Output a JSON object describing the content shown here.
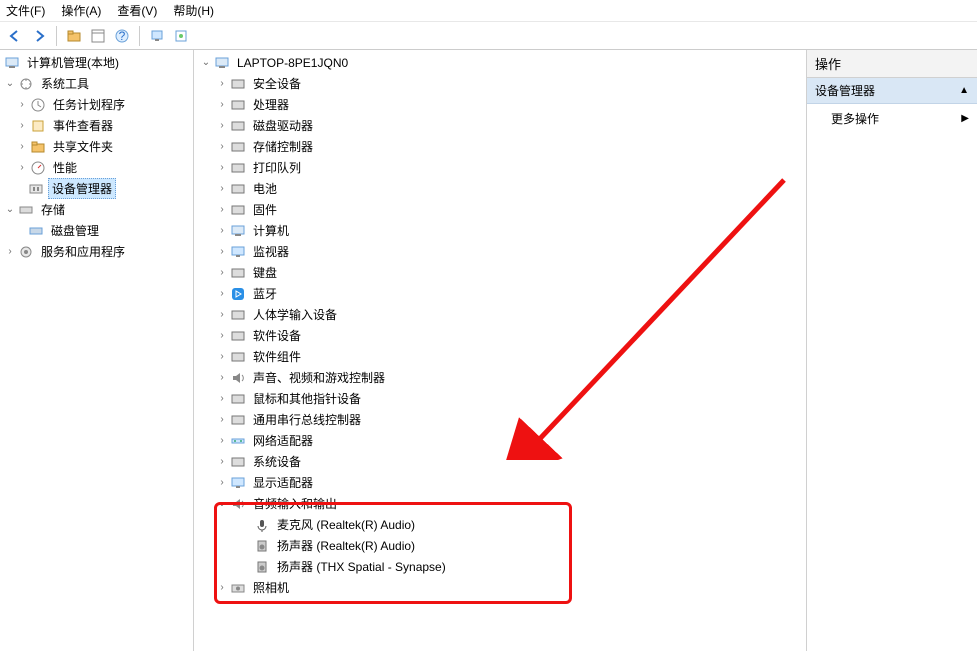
{
  "menu": {
    "file": "文件(F)",
    "operate": "操作(A)",
    "view": "查看(V)",
    "help": "帮助(H)"
  },
  "left_tree": {
    "root": {
      "label": "计算机管理(本地)"
    },
    "systools": {
      "label": "系统工具"
    },
    "task": {
      "label": "任务计划程序"
    },
    "event": {
      "label": "事件查看器"
    },
    "shared": {
      "label": "共享文件夹"
    },
    "perf": {
      "label": "性能"
    },
    "devmgr": {
      "label": "设备管理器"
    },
    "storage": {
      "label": "存储"
    },
    "diskmgr": {
      "label": "磁盘管理"
    },
    "services": {
      "label": "服务和应用程序"
    }
  },
  "center_tree": {
    "root": {
      "label": "LAPTOP-8PE1JQN0"
    },
    "items": [
      {
        "label": "安全设备",
        "icon": "security"
      },
      {
        "label": "处理器",
        "icon": "cpu"
      },
      {
        "label": "磁盘驱动器",
        "icon": "disk"
      },
      {
        "label": "存储控制器",
        "icon": "storagectl"
      },
      {
        "label": "打印队列",
        "icon": "printer"
      },
      {
        "label": "电池",
        "icon": "battery"
      },
      {
        "label": "固件",
        "icon": "firmware"
      },
      {
        "label": "计算机",
        "icon": "computer"
      },
      {
        "label": "监视器",
        "icon": "monitor"
      },
      {
        "label": "键盘",
        "icon": "keyboard"
      },
      {
        "label": "蓝牙",
        "icon": "bluetooth"
      },
      {
        "label": "人体学输入设备",
        "icon": "hid"
      },
      {
        "label": "软件设备",
        "icon": "softdev"
      },
      {
        "label": "软件组件",
        "icon": "softcomp"
      },
      {
        "label": "声音、视频和游戏控制器",
        "icon": "sound"
      },
      {
        "label": "鼠标和其他指针设备",
        "icon": "mouse"
      },
      {
        "label": "通用串行总线控制器",
        "icon": "usb"
      },
      {
        "label": "网络适配器",
        "icon": "network"
      },
      {
        "label": "系统设备",
        "icon": "system"
      },
      {
        "label": "显示适配器",
        "icon": "display"
      }
    ],
    "audio_group": {
      "label": "音频输入和输出"
    },
    "audio_children": [
      {
        "label": "麦克风 (Realtek(R) Audio)",
        "icon": "mic"
      },
      {
        "label": "扬声器 (Realtek(R) Audio)",
        "icon": "speaker"
      },
      {
        "label": "扬声器 (THX Spatial - Synapse)",
        "icon": "speaker"
      }
    ],
    "camera": {
      "label": "照相机"
    }
  },
  "right": {
    "header": "操作",
    "subheader": "设备管理器",
    "more": "更多操作"
  }
}
